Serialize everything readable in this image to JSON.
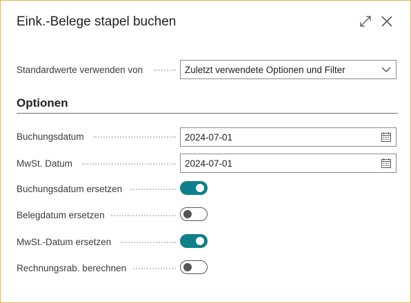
{
  "dialog": {
    "title": "Eink.-Belege stapel buchen",
    "expand_icon": "expand-diagonal-icon",
    "close_icon": "close-icon"
  },
  "defaults": {
    "label": "Standardwerte verwenden von",
    "value": "Zuletzt verwendete Optionen und Filter",
    "icon": "chevron-down-icon"
  },
  "options": {
    "heading": "Optionen",
    "posting_date": {
      "label": "Buchungsdatum",
      "value": "2024-07-01",
      "icon": "calendar-icon"
    },
    "vat_date": {
      "label": "MwSt. Datum",
      "value": "2024-07-01",
      "icon": "calendar-icon"
    },
    "replace_posting_date": {
      "label": "Buchungsdatum ersetzen",
      "checked": true
    },
    "replace_document_date": {
      "label": "Belegdatum ersetzen",
      "checked": false
    },
    "replace_vat_date": {
      "label": "MwSt.-Datum ersetzen",
      "checked": true
    },
    "calc_invoice_discount": {
      "label": "Rechnungsrab. berechnen",
      "checked": false
    }
  },
  "colors": {
    "accent": "#0f7f8c",
    "frame": "#e8b54a"
  }
}
